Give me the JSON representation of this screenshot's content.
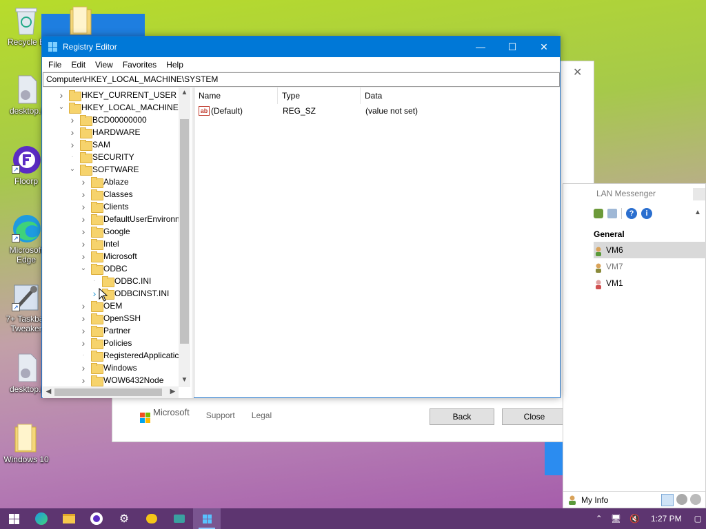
{
  "desktop": {
    "icons": [
      {
        "label": "Recycle B",
        "icon": "recycle-bin-icon"
      },
      {
        "label": "desktop.i",
        "icon": "settings-file-icon"
      },
      {
        "label": "Floorp",
        "icon": "floorp-browser-icon"
      },
      {
        "label": "Microsoft Edge",
        "icon": "edge-icon"
      },
      {
        "label": "7+ Taskbar Tweaker",
        "icon": "tweaker-icon"
      },
      {
        "label": "desktop.i",
        "icon": "settings-file-icon"
      },
      {
        "label": "Windows 10",
        "icon": "folder-icon"
      }
    ]
  },
  "bg_dialog": {
    "brand": "Microsoft",
    "links": [
      "Support",
      "Legal"
    ],
    "back_label": "Back",
    "close_label": "Close"
  },
  "lan": {
    "title": "LAN Messenger",
    "group": "General",
    "users": [
      "VM6",
      "VM7",
      "VM1"
    ],
    "my_info": "My Info"
  },
  "regedit": {
    "title": "Registry Editor",
    "menu": [
      "File",
      "Edit",
      "View",
      "Favorites",
      "Help"
    ],
    "address": "Computer\\HKEY_LOCAL_MACHINE\\SYSTEM",
    "tree": [
      {
        "label": "HKEY_CURRENT_USER",
        "level": 0,
        "state": "collapsed"
      },
      {
        "label": "HKEY_LOCAL_MACHINE",
        "level": 0,
        "state": "expanded"
      },
      {
        "label": "BCD00000000",
        "level": 1,
        "state": "collapsed"
      },
      {
        "label": "HARDWARE",
        "level": 1,
        "state": "collapsed"
      },
      {
        "label": "SAM",
        "level": 1,
        "state": "collapsed"
      },
      {
        "label": "SECURITY",
        "level": 1,
        "state": "none"
      },
      {
        "label": "SOFTWARE",
        "level": 1,
        "state": "expanded"
      },
      {
        "label": "Ablaze",
        "level": 2,
        "state": "collapsed"
      },
      {
        "label": "Classes",
        "level": 2,
        "state": "collapsed"
      },
      {
        "label": "Clients",
        "level": 2,
        "state": "collapsed"
      },
      {
        "label": "DefaultUserEnvironn",
        "level": 2,
        "state": "collapsed"
      },
      {
        "label": "Google",
        "level": 2,
        "state": "collapsed"
      },
      {
        "label": "Intel",
        "level": 2,
        "state": "collapsed"
      },
      {
        "label": "Microsoft",
        "level": 2,
        "state": "collapsed"
      },
      {
        "label": "ODBC",
        "level": 2,
        "state": "expanded"
      },
      {
        "label": "ODBC.INI",
        "level": 3,
        "state": "none"
      },
      {
        "label": "ODBCINST.INI",
        "level": 3,
        "state": "collapsed-hover"
      },
      {
        "label": "OEM",
        "level": 2,
        "state": "collapsed"
      },
      {
        "label": "OpenSSH",
        "level": 2,
        "state": "collapsed"
      },
      {
        "label": "Partner",
        "level": 2,
        "state": "collapsed"
      },
      {
        "label": "Policies",
        "level": 2,
        "state": "collapsed"
      },
      {
        "label": "RegisteredApplicatic",
        "level": 2,
        "state": "none"
      },
      {
        "label": "Windows",
        "level": 2,
        "state": "collapsed"
      },
      {
        "label": "WOW6432Node",
        "level": 2,
        "state": "collapsed"
      }
    ],
    "columns": [
      "Name",
      "Type",
      "Data"
    ],
    "values": [
      {
        "name": "(Default)",
        "type": "REG_SZ",
        "data": "(value not set)"
      }
    ]
  },
  "taskbar": {
    "apps": [
      "start-icon",
      "edge-icon",
      "file-explorer-icon",
      "floorp-icon",
      "settings-icon",
      "messenger-icon",
      "lan-icon",
      "regedit-icon"
    ],
    "clock": "1:27 PM"
  }
}
